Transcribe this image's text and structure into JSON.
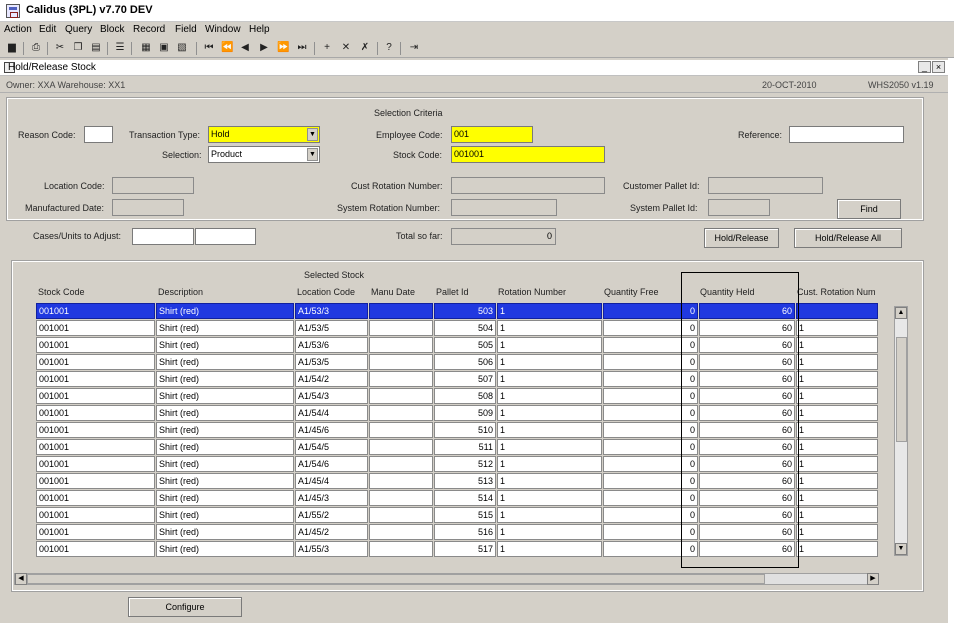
{
  "app_title": "Calidus (3PL) v7.70 DEV",
  "menu": [
    "Action",
    "Edit",
    "Query",
    "Block",
    "Record",
    "Field",
    "Window",
    "Help"
  ],
  "toolbar_icons": [
    "save-icon",
    "print-icon",
    "cut-icon",
    "copy-icon",
    "paste-icon",
    "clear-icon",
    "grid-icon",
    "copy-record-icon",
    "paste-record-icon",
    "first-record-icon",
    "previous-set-icon",
    "previous-record-icon",
    "next-record-icon",
    "next-set-icon",
    "last-record-icon",
    "insert-record-icon",
    "delete-record-icon",
    "duplicate-record-icon",
    "help-icon",
    "exit-icon"
  ],
  "window": {
    "title": "Hold/Release Stock",
    "owner": "Owner: XXA    Warehouse: XX1",
    "date": "20-OCT-2010",
    "form_code": "WHS2050  v1.19"
  },
  "selection": {
    "heading": "Selection Criteria",
    "reason_code_label": "Reason Code:",
    "reason_code_value": "",
    "transaction_type_label": "Transaction Type:",
    "transaction_type_value": "Hold",
    "employee_code_label": "Employee Code:",
    "employee_code_value": "001",
    "reference_label": "Reference:",
    "reference_value": "",
    "selection_label": "Selection:",
    "selection_value": "Product",
    "stock_code_label": "Stock Code:",
    "stock_code_value": "001001",
    "location_code_label": "Location Code:",
    "cust_rotation_label": "Cust Rotation Number:",
    "customer_pallet_label": "Customer Pallet Id:",
    "manufactured_date_label": "Manufactured Date:",
    "system_rotation_label": "System Rotation Number:",
    "system_pallet_label": "System Pallet Id:",
    "find_label": "Find"
  },
  "adjust": {
    "cases_units_label": "Cases/Units to Adjust:",
    "total_so_far_label": "Total so far:",
    "total_so_far_value": "0",
    "hold_release_label": "Hold/Release",
    "hold_release_all_label": "Hold/Release All"
  },
  "grid": {
    "heading": "Selected Stock",
    "columns": [
      "Stock Code",
      "Description",
      "Location Code",
      "Manu Date",
      "Pallet Id",
      "Rotation Number",
      "Quantity Free",
      "Quantity Held",
      "Cust. Rotation Num"
    ],
    "rows": [
      {
        "stock": "001001",
        "desc": "Shirt (red)",
        "loc": "A1/53/3",
        "manu": "",
        "pallet": "503",
        "rot": "1",
        "free": "0",
        "held": "60",
        "cust": ""
      },
      {
        "stock": "001001",
        "desc": "Shirt (red)",
        "loc": "A1/53/5",
        "manu": "",
        "pallet": "504",
        "rot": "1",
        "free": "0",
        "held": "60",
        "cust": "1"
      },
      {
        "stock": "001001",
        "desc": "Shirt (red)",
        "loc": "A1/53/6",
        "manu": "",
        "pallet": "505",
        "rot": "1",
        "free": "0",
        "held": "60",
        "cust": "1"
      },
      {
        "stock": "001001",
        "desc": "Shirt (red)",
        "loc": "A1/53/5",
        "manu": "",
        "pallet": "506",
        "rot": "1",
        "free": "0",
        "held": "60",
        "cust": "1"
      },
      {
        "stock": "001001",
        "desc": "Shirt (red)",
        "loc": "A1/54/2",
        "manu": "",
        "pallet": "507",
        "rot": "1",
        "free": "0",
        "held": "60",
        "cust": "1"
      },
      {
        "stock": "001001",
        "desc": "Shirt (red)",
        "loc": "A1/54/3",
        "manu": "",
        "pallet": "508",
        "rot": "1",
        "free": "0",
        "held": "60",
        "cust": "1"
      },
      {
        "stock": "001001",
        "desc": "Shirt (red)",
        "loc": "A1/54/4",
        "manu": "",
        "pallet": "509",
        "rot": "1",
        "free": "0",
        "held": "60",
        "cust": "1"
      },
      {
        "stock": "001001",
        "desc": "Shirt (red)",
        "loc": "A1/45/6",
        "manu": "",
        "pallet": "510",
        "rot": "1",
        "free": "0",
        "held": "60",
        "cust": "1"
      },
      {
        "stock": "001001",
        "desc": "Shirt (red)",
        "loc": "A1/54/5",
        "manu": "",
        "pallet": "511",
        "rot": "1",
        "free": "0",
        "held": "60",
        "cust": "1"
      },
      {
        "stock": "001001",
        "desc": "Shirt (red)",
        "loc": "A1/54/6",
        "manu": "",
        "pallet": "512",
        "rot": "1",
        "free": "0",
        "held": "60",
        "cust": "1"
      },
      {
        "stock": "001001",
        "desc": "Shirt (red)",
        "loc": "A1/45/4",
        "manu": "",
        "pallet": "513",
        "rot": "1",
        "free": "0",
        "held": "60",
        "cust": "1"
      },
      {
        "stock": "001001",
        "desc": "Shirt (red)",
        "loc": "A1/45/3",
        "manu": "",
        "pallet": "514",
        "rot": "1",
        "free": "0",
        "held": "60",
        "cust": "1"
      },
      {
        "stock": "001001",
        "desc": "Shirt (red)",
        "loc": "A1/55/2",
        "manu": "",
        "pallet": "515",
        "rot": "1",
        "free": "0",
        "held": "60",
        "cust": "1"
      },
      {
        "stock": "001001",
        "desc": "Shirt (red)",
        "loc": "A1/45/2",
        "manu": "",
        "pallet": "516",
        "rot": "1",
        "free": "0",
        "held": "60",
        "cust": "1"
      },
      {
        "stock": "001001",
        "desc": "Shirt (red)",
        "loc": "A1/55/3",
        "manu": "",
        "pallet": "517",
        "rot": "1",
        "free": "0",
        "held": "60",
        "cust": "1"
      }
    ]
  },
  "configure_label": "Configure",
  "colors": {
    "selected_row": "#2038e0",
    "required_field": "#ffff00"
  }
}
